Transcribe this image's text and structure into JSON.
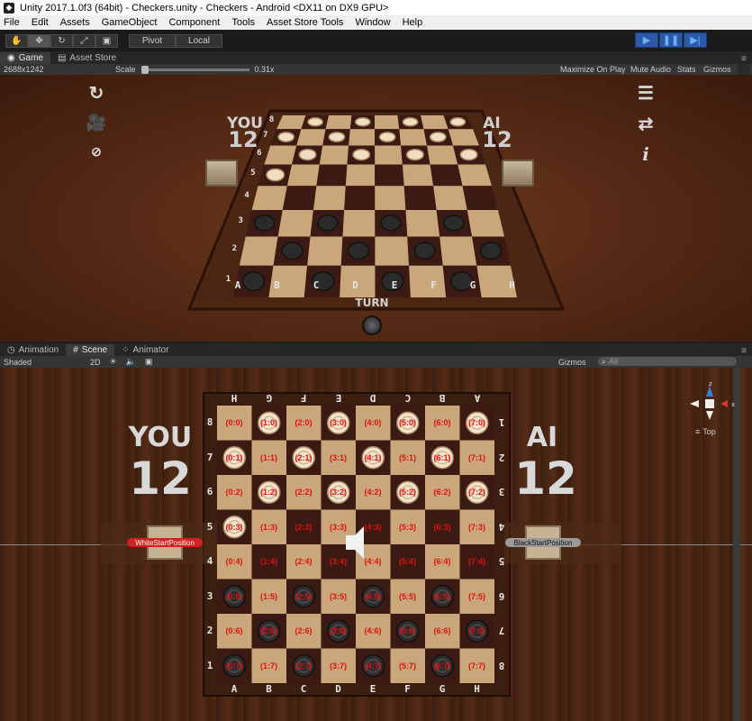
{
  "window_title": "Unity 2017.1.0f3 (64bit) - Checkers.unity - Checkers - Android <DX11 on DX9 GPU>",
  "menu": [
    "File",
    "Edit",
    "Assets",
    "GameObject",
    "Component",
    "Tools",
    "Asset Store Tools",
    "Window",
    "Help"
  ],
  "toolbar": {
    "pivot_label": "Pivot",
    "local_label": "Local"
  },
  "top_tabs": [
    {
      "label": "Game"
    },
    {
      "label": "Asset Store"
    }
  ],
  "game_bar": {
    "resolution": "2688x1242",
    "scale_label": "Scale",
    "scale_value": "0.31x",
    "maximize": "Maximize On Play",
    "mute": "Mute Audio",
    "stats": "Stats",
    "gizmos": "Gizmos"
  },
  "game": {
    "you_label": "YOU",
    "you_score": "12",
    "ai_label": "AI",
    "ai_score": "12",
    "turn_label": "TURN",
    "files": [
      "A",
      "B",
      "C",
      "D",
      "E",
      "F",
      "G",
      "H"
    ],
    "ranks": [
      "1",
      "2",
      "3",
      "4",
      "5",
      "6",
      "7",
      "8"
    ]
  },
  "bottom_tabs": [
    {
      "label": "Animation"
    },
    {
      "label": "Scene"
    },
    {
      "label": "Animator"
    }
  ],
  "scene_bar": {
    "shading": "Shaded",
    "mode_2d": "2D",
    "gizmos": "Gizmos",
    "search_placeholder": "All"
  },
  "scene": {
    "you_label": "YOU",
    "you_score": "12",
    "ai_label": "AI",
    "ai_score": "12",
    "white_start": "WhiteStartPosition",
    "black_start": "BlackStartPosition",
    "top_view": "Top",
    "coords": [
      [
        "(0:0)",
        "(1:0)",
        "(2:0)",
        "(3:0)",
        "(4:0)",
        "(5:0)",
        "(6:0)",
        "(7:0)"
      ],
      [
        "(0:1)",
        "(1:1)",
        "(2:1)",
        "(3:1)",
        "(4:1)",
        "(5:1)",
        "(6:1)",
        "(7:1)"
      ],
      [
        "(0:2)",
        "(1:2)",
        "(2:2)",
        "(3:2)",
        "(4:2)",
        "(5:2)",
        "(6:2)",
        "(7:2)"
      ],
      [
        "(0:3)",
        "(1:3)",
        "(2:3)",
        "(3:3)",
        "(4:3)",
        "(5:3)",
        "(6:3)",
        "(7:3)"
      ],
      [
        "(0:4)",
        "(1:4)",
        "(2:4)",
        "(3:4)",
        "(4:4)",
        "(5:4)",
        "(6:4)",
        "(7:4)"
      ],
      [
        "(0:5)",
        "(1:5)",
        "(2:5)",
        "(3:5)",
        "(4:5)",
        "(5:5)",
        "(6:5)",
        "(7:5)"
      ],
      [
        "(0:6)",
        "(1:6)",
        "(2:6)",
        "(3:6)",
        "(4:6)",
        "(5:6)",
        "(6:6)",
        "(7:6)"
      ],
      [
        "(0:7)",
        "(1:7)",
        "(2:7)",
        "(3:7)",
        "(4:7)",
        "(5:7)",
        "(6:7)",
        "(7:7)"
      ]
    ],
    "white_pieces": [
      [
        1,
        0
      ],
      [
        3,
        0
      ],
      [
        5,
        0
      ],
      [
        7,
        0
      ],
      [
        0,
        1
      ],
      [
        2,
        1
      ],
      [
        4,
        1
      ],
      [
        6,
        1
      ],
      [
        1,
        2
      ],
      [
        3,
        2
      ],
      [
        5,
        2
      ],
      [
        7,
        2
      ],
      [
        0,
        3
      ]
    ],
    "black_pieces": [
      [
        0,
        5
      ],
      [
        2,
        5
      ],
      [
        4,
        5
      ],
      [
        6,
        5
      ],
      [
        1,
        6
      ],
      [
        3,
        6
      ],
      [
        5,
        6
      ],
      [
        7,
        6
      ],
      [
        0,
        7
      ],
      [
        2,
        7
      ],
      [
        4,
        7
      ],
      [
        6,
        7
      ]
    ]
  },
  "colors": {
    "accent": "#2d5aa8",
    "white_marker": "#d42020",
    "black_marker": "#9a9a9a",
    "coord_text": "#e01010"
  }
}
